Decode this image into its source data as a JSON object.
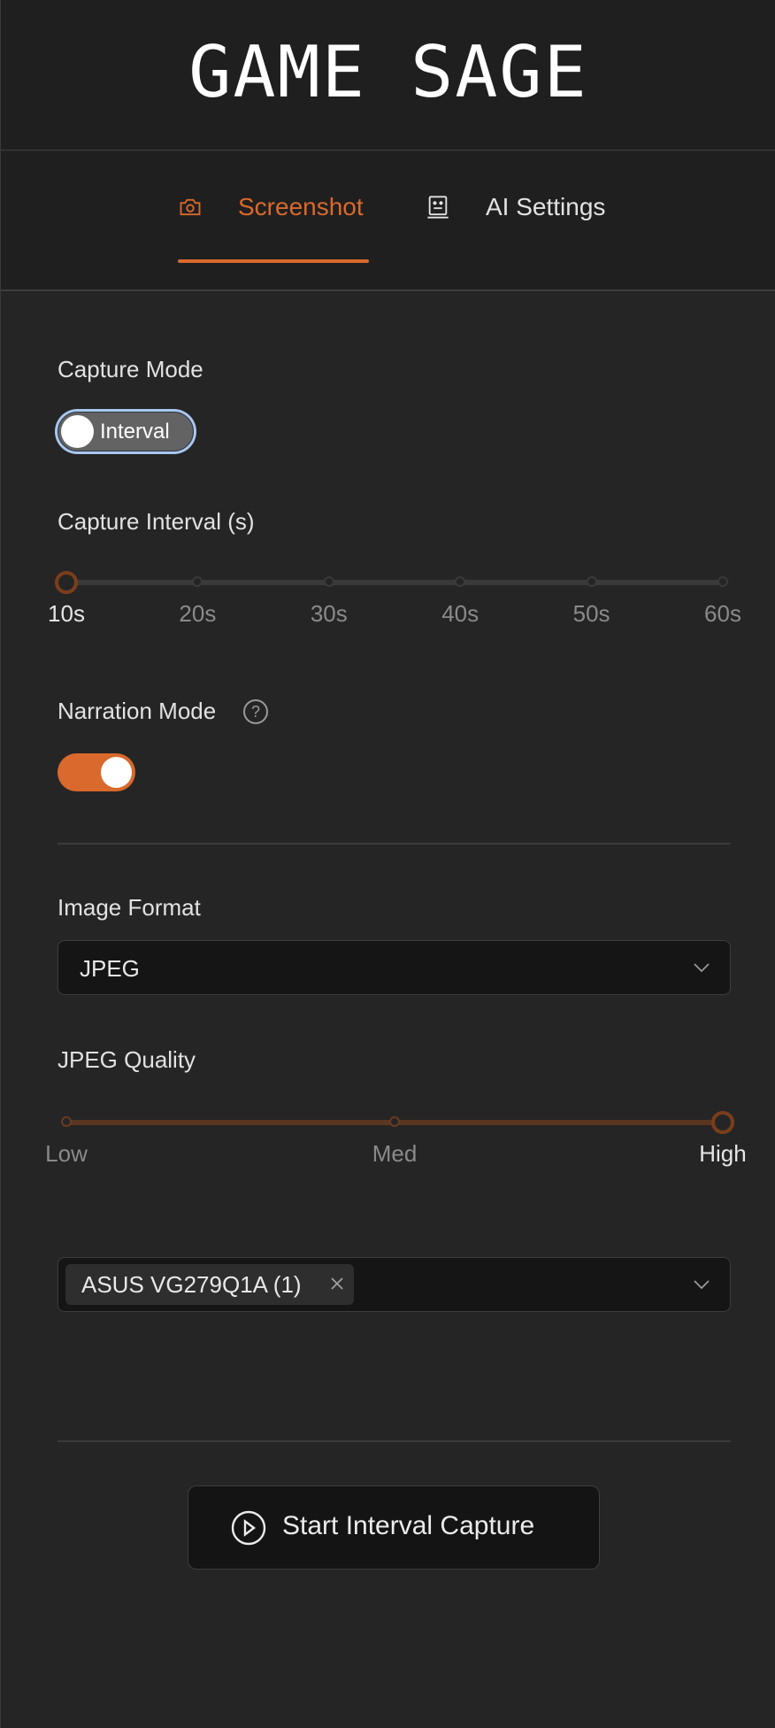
{
  "app": {
    "title": "GAME SAGE"
  },
  "tabs": [
    {
      "label": "Screenshot",
      "icon": "camera-icon",
      "active": true
    },
    {
      "label": "AI Settings",
      "icon": "robot-icon",
      "active": false
    }
  ],
  "capture_mode": {
    "label": "Capture Mode",
    "toggle_text": "Interval",
    "checked": false
  },
  "capture_interval": {
    "label": "Capture Interval (s)",
    "marks": [
      "10s",
      "20s",
      "30s",
      "40s",
      "50s",
      "60s"
    ],
    "value_index": 0
  },
  "narration_mode": {
    "label": "Narration Mode",
    "help_icon": "question-circle-icon",
    "help_glyph": "?",
    "enabled": true
  },
  "image_format": {
    "label": "Image Format",
    "value": "JPEG"
  },
  "jpeg_quality": {
    "label": "JPEG Quality",
    "marks": [
      "Low",
      "Med",
      "High"
    ],
    "value_index": 2
  },
  "monitor_select": {
    "selected": [
      "ASUS VG279Q1A (1)"
    ]
  },
  "actions": {
    "start_label": "Start Interval Capture",
    "start_icon": "play-circle-icon"
  },
  "colors": {
    "accent": "#d9692d",
    "background": "#252525",
    "header_bg": "#1f1f1f",
    "focus_ring": "#a9c7ef"
  }
}
